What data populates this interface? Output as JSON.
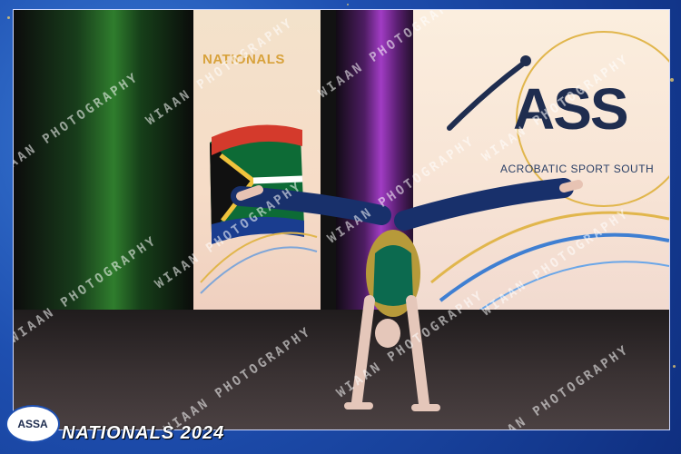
{
  "scene": {
    "banner_left_text": "NATIONALS",
    "banner_right_logo": "ASS",
    "banner_right_text": "ACROBATIC SPORT SOUTH",
    "watermark_text": "WIAAN PHOTOGRAPHY",
    "footer_logo_text": "ASSA",
    "footer_text": "NATIONALS 2024"
  }
}
